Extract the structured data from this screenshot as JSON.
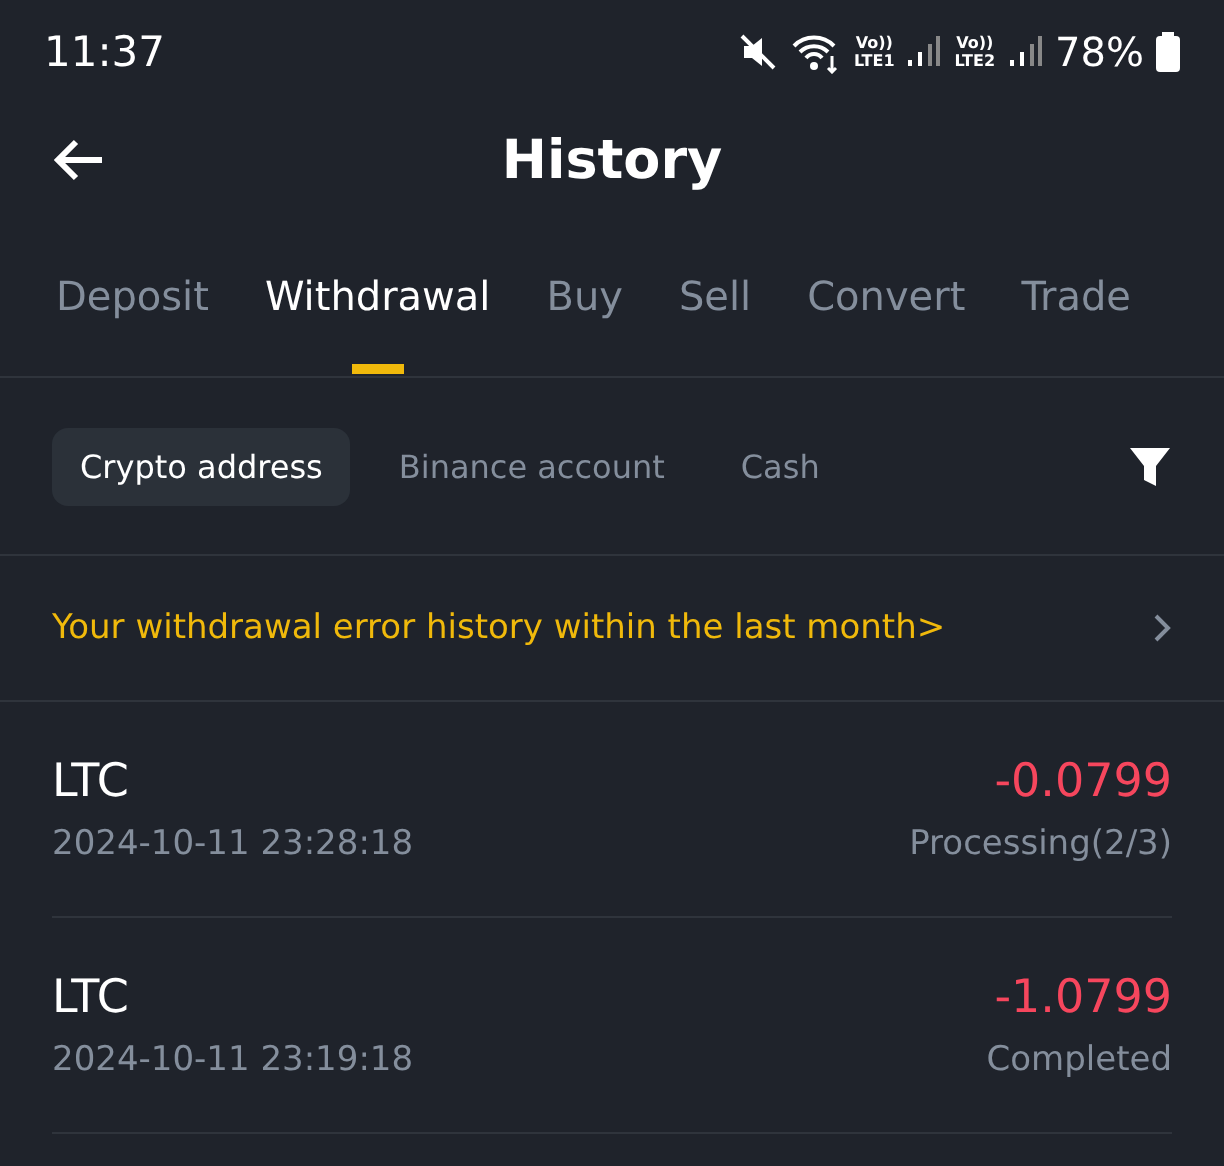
{
  "status_bar": {
    "time": "11:37",
    "sim1": {
      "volte": "Vo))",
      "network": "LTE1"
    },
    "sim2": {
      "volte": "Vo))",
      "network": "LTE2"
    },
    "battery": "78%"
  },
  "header": {
    "title": "History"
  },
  "tabs": [
    {
      "label": "Deposit",
      "selected": false
    },
    {
      "label": "Withdrawal",
      "selected": true
    },
    {
      "label": "Buy",
      "selected": false
    },
    {
      "label": "Sell",
      "selected": false
    },
    {
      "label": "Convert",
      "selected": false
    },
    {
      "label": "Trade",
      "selected": false
    }
  ],
  "filters": [
    {
      "label": "Crypto address",
      "selected": true
    },
    {
      "label": "Binance account",
      "selected": false
    },
    {
      "label": "Cash",
      "selected": false
    }
  ],
  "notice": "Your withdrawal error history within the last month>",
  "records": [
    {
      "coin": "LTC",
      "time": "2024-10-11 23:28:18",
      "amount": "-0.0799",
      "status": "Processing(2/3)"
    },
    {
      "coin": "LTC",
      "time": "2024-10-11 23:19:18",
      "amount": "-1.0799",
      "status": "Completed"
    }
  ]
}
